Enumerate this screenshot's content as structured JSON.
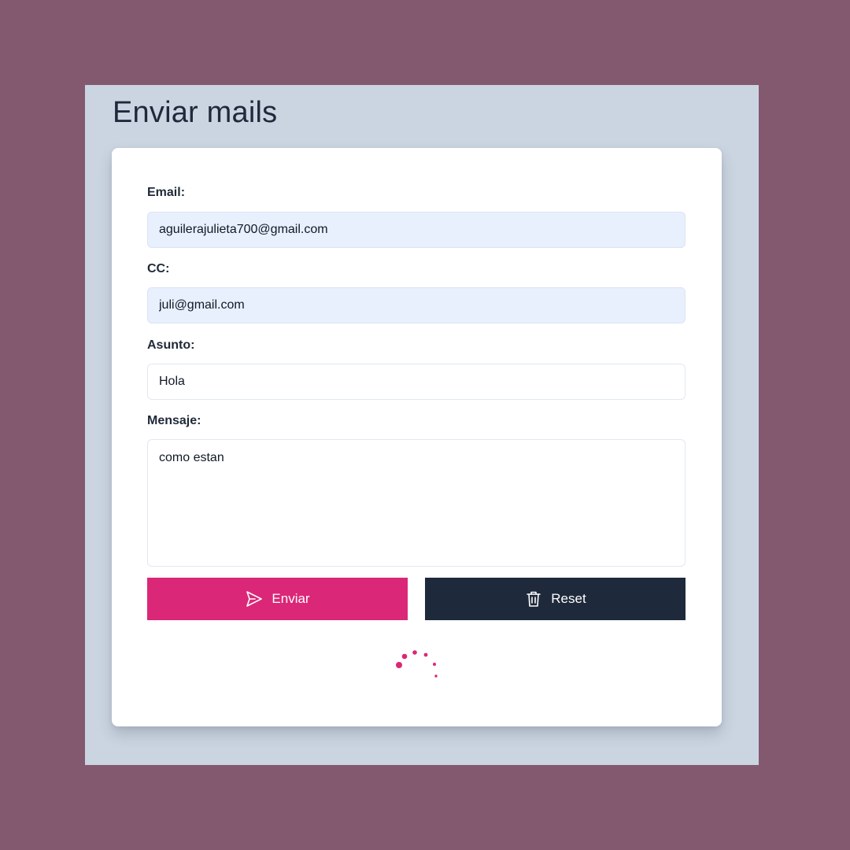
{
  "page": {
    "title": "Enviar mails"
  },
  "form": {
    "email": {
      "label": "Email:",
      "value": "aguilerajulieta700@gmail.com"
    },
    "cc": {
      "label": "CC:",
      "value": "juli@gmail.com"
    },
    "subject": {
      "label": "Asunto:",
      "value": "Hola"
    },
    "message": {
      "label": "Mensaje:",
      "value": "como estan"
    },
    "buttons": {
      "send_label": "Enviar",
      "send_icon": "send-icon",
      "reset_label": "Reset",
      "reset_icon": "trash-icon"
    },
    "loading": true
  },
  "colors": {
    "background": "#83596f",
    "frame": "#cbd5e1",
    "accent": "#db2777",
    "dark": "#1e293b",
    "autofill": "#e8f0fe"
  }
}
